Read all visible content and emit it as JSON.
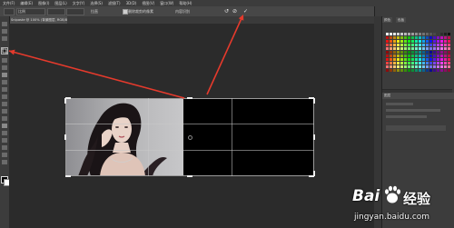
{
  "menubar": {
    "items": [
      "文件(F)",
      "编辑(E)",
      "图像(I)",
      "图层(L)",
      "文字(Y)",
      "选择(S)",
      "滤镜(T)",
      "3D(D)",
      "视图(V)",
      "窗口(W)",
      "帮助(H)"
    ]
  },
  "options_bar": {
    "ratio_value": "比例",
    "straighten_label": "拉直",
    "delete_cropped_label": "删除裁剪的像素",
    "content_aware_label": "内容识别",
    "cancel_symbol": "⊘",
    "commit_symbol": "✓"
  },
  "document_tab": {
    "label": "Snipaste @ 100% (背景图层, RGB/8#)"
  },
  "right_panel": {
    "tabs": [
      "颜色",
      "色板"
    ],
    "layers_tab": "图层"
  },
  "watermark": {
    "brand_latin": "Bai",
    "brand_cn": "经验",
    "url": "jingyan.baidu.com"
  },
  "colors": {
    "arrow": "#e53a2c",
    "crop_grid": "#c8c8c8",
    "workspace": "#2b2b2b"
  }
}
